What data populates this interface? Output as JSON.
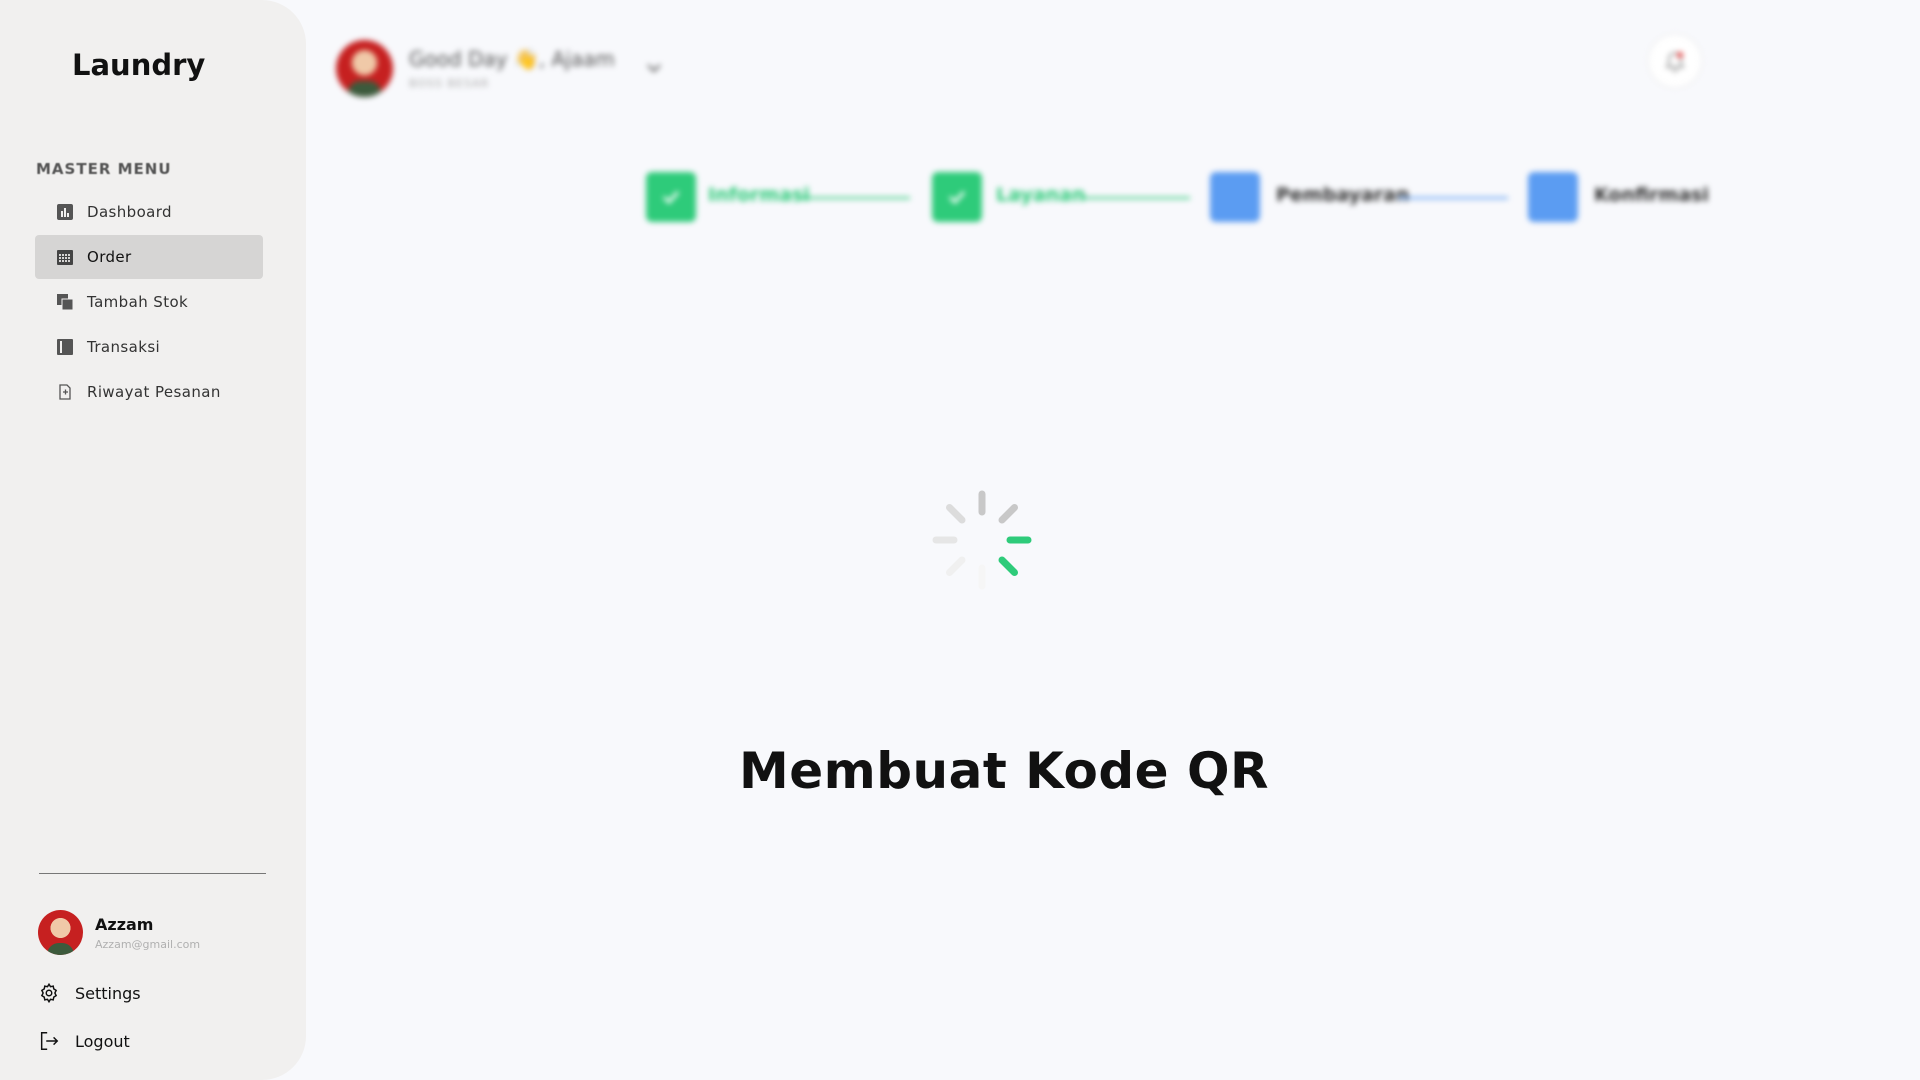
{
  "sidebar": {
    "brand": "Laundry",
    "menu_heading": "MASTER MENU",
    "items": [
      {
        "label": "Dashboard",
        "icon": "chart-icon",
        "active": false
      },
      {
        "label": "Order",
        "icon": "calendar-icon",
        "active": true
      },
      {
        "label": "Tambah Stok",
        "icon": "stack-icon",
        "active": false
      },
      {
        "label": "Transaksi",
        "icon": "book-icon",
        "active": false
      },
      {
        "label": "Riwayat Pesanan",
        "icon": "document-icon",
        "active": false
      }
    ],
    "user": {
      "name": "Azzam",
      "email": "Azzam@gmail.com"
    },
    "settings_label": "Settings",
    "logout_label": "Logout"
  },
  "header": {
    "greeting": "Good Day 👋, Ajaam",
    "role": "BOSS BESAR"
  },
  "stepper": {
    "steps": [
      {
        "label": "Informasi",
        "status": "done"
      },
      {
        "label": "Layanan",
        "status": "done"
      },
      {
        "label": "Pembayaran",
        "status": "todo"
      },
      {
        "label": "Konfirmasi",
        "status": "todo"
      }
    ]
  },
  "loading": {
    "title": "Membuat Kode QR"
  },
  "colors": {
    "accent_green": "#2ecb7a",
    "accent_blue": "#5b9cf2",
    "sidebar_bg": "#f1f0ef",
    "active_item_bg": "#d6d5d4"
  }
}
